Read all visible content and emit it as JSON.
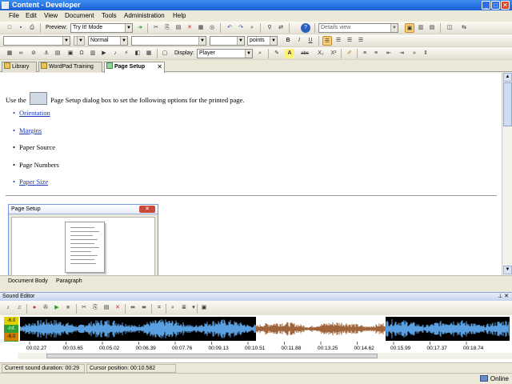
{
  "window": {
    "title": "Content - Developer",
    "controls": {
      "minimize": "_",
      "maximize": "□",
      "close": "✕"
    }
  },
  "menu": [
    "File",
    "Edit",
    "View",
    "Document",
    "Tools",
    "Administration",
    "Help"
  ],
  "toolbar1": {
    "preview_label": "Preview:",
    "preview_mode": "Try It! Mode",
    "view_select": "Details view"
  },
  "toolbar2": {
    "style": "Normal",
    "font": "",
    "size": "",
    "size_unit": "points",
    "bold": "B",
    "italic": "I",
    "underline": "U"
  },
  "toolbar3": {
    "display_label": "Display:",
    "display_value": "Player",
    "highlight": "A",
    "strike": "abc",
    "subscript": "X₂",
    "superscript": "X²"
  },
  "tabs": [
    {
      "label": "Library",
      "active": false
    },
    {
      "label": "WordPad Training",
      "active": false
    },
    {
      "label": "Page Setup",
      "active": true
    }
  ],
  "document": {
    "intro_before": "Use the",
    "intro_after": "Page Setup dialog box to set the following options for the printed page.",
    "bullets": [
      {
        "text": "Orientation",
        "link": true
      },
      {
        "text": "Margins",
        "link": true
      },
      {
        "text": "Paper Source",
        "link": false
      },
      {
        "text": "Page Numbers",
        "link": false
      },
      {
        "text": "Paper Size",
        "link": true
      }
    ],
    "dialog": {
      "title": "Page Setup",
      "close": "✕"
    }
  },
  "doc_status": {
    "body": "Document Body",
    "paragraph": "Paragraph"
  },
  "sound_editor": {
    "title": "Sound Editor",
    "meter": [
      "-6.0",
      "-Inf.",
      "-6.0"
    ],
    "timestamps": [
      "00:02.27",
      "00:03.65",
      "00:05.02",
      "00:06.39",
      "00:07.76",
      "00:09.13",
      "00:10.51",
      "00:11.88",
      "00:13.25",
      "00:14.62",
      "00:15.99",
      "00:17.37",
      "00:18.74"
    ]
  },
  "status": {
    "duration": "Current sound duration: 00:29",
    "cursor": "Cursor position: 00:10.582"
  },
  "connection": "Online",
  "colors": {
    "titlebar": "#1a5fd4",
    "wave_blue": "#5aa0e0",
    "wave_brown": "#a0643a",
    "link": "#1a35b8"
  }
}
